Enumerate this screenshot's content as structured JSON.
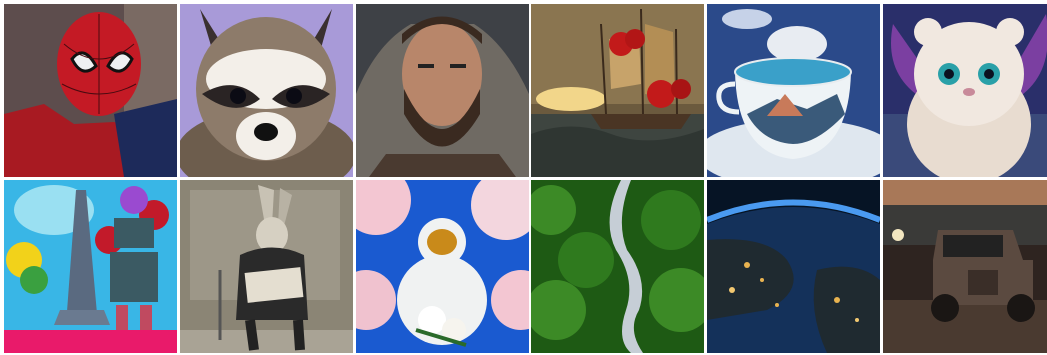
{
  "gallery": {
    "tiles": [
      {
        "subject": "spider-man",
        "colors": {
          "bg": "#5d4d4d",
          "main": "#c41a25",
          "accent": "#1d2a5a"
        }
      },
      {
        "subject": "raccoon",
        "colors": {
          "bg": "#a89ad8",
          "main": "#8d7b6a",
          "accent": "#f3efe9"
        }
      },
      {
        "subject": "bearded-man-portrait",
        "colors": {
          "bg": "#3e4146",
          "main": "#b8866a",
          "accent": "#3a2a20"
        }
      },
      {
        "subject": "ship-with-red-roses",
        "colors": {
          "bg": "#6b5a3e",
          "main": "#c7a36a",
          "accent": "#c21a1a"
        }
      },
      {
        "subject": "teacup-with-landscape",
        "colors": {
          "bg": "#2b4a8a",
          "main": "#eef3f6",
          "accent": "#3aa0c9"
        }
      },
      {
        "subject": "white-fluffy-creature",
        "colors": {
          "bg": "#2a2f6a",
          "main": "#f1e8e0",
          "accent": "#7b3fa1"
        }
      },
      {
        "subject": "eiffel-tower-and-robot",
        "colors": {
          "bg": "#39b6e6",
          "main": "#3b5a63",
          "accent": "#e91a6a"
        }
      },
      {
        "subject": "rabbit-reading-newspaper",
        "colors": {
          "bg": "#8b8575",
          "main": "#2a2a2a",
          "accent": "#e4ded0"
        }
      },
      {
        "subject": "astronaut-cherry-blossoms",
        "colors": {
          "bg": "#1a5ad0",
          "main": "#f0f2f2",
          "accent": "#f3c6d2"
        }
      },
      {
        "subject": "aerial-forest-river",
        "colors": {
          "bg": "#1e5a14",
          "main": "#3c8a26",
          "accent": "#c6ced6"
        }
      },
      {
        "subject": "earth-city-lights",
        "colors": {
          "bg": "#061425",
          "main": "#14315a",
          "accent": "#e8b350"
        }
      },
      {
        "subject": "vintage-truck-at-night",
        "colors": {
          "bg": "#2e2420",
          "main": "#5b4a40",
          "accent": "#f2e6c0"
        }
      }
    ]
  }
}
